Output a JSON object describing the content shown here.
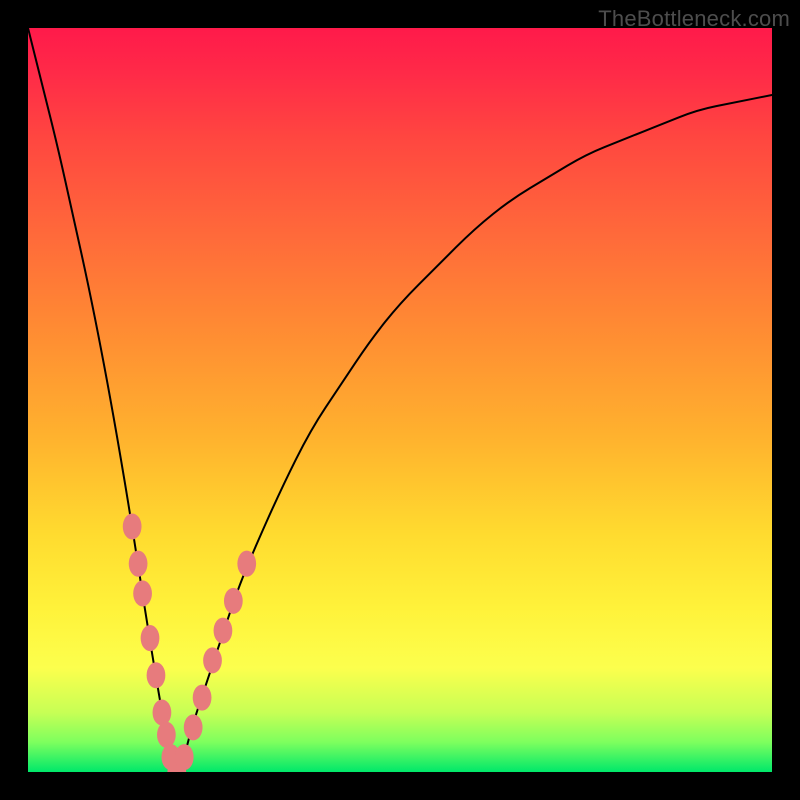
{
  "watermark": "TheBottleneck.com",
  "colors": {
    "frame": "#000000",
    "marker": "#e77b7d",
    "gradient_top": "#ff1a4a",
    "gradient_bottom": "#00e86a"
  },
  "chart_data": {
    "type": "line",
    "title": "",
    "xlabel": "",
    "ylabel": "",
    "xlim": [
      0,
      100
    ],
    "ylim": [
      0,
      100
    ],
    "grid": false,
    "legend": false,
    "series": [
      {
        "name": "bottleneck-curve",
        "x": [
          0,
          2,
          4,
          6,
          8,
          10,
          12,
          14,
          16,
          18,
          19,
          20,
          21,
          22,
          24,
          26,
          28,
          30,
          34,
          38,
          42,
          46,
          50,
          55,
          60,
          65,
          70,
          75,
          80,
          85,
          90,
          95,
          100
        ],
        "y": [
          100,
          92,
          84,
          75,
          66,
          56,
          45,
          33,
          20,
          8,
          3,
          0,
          2,
          6,
          12,
          18,
          24,
          29,
          38,
          46,
          52,
          58,
          63,
          68,
          73,
          77,
          80,
          83,
          85,
          87,
          89,
          90,
          91
        ]
      }
    ],
    "markers": [
      {
        "x": 14.0,
        "y": 33,
        "r": 1.4
      },
      {
        "x": 14.8,
        "y": 28,
        "r": 1.4
      },
      {
        "x": 15.4,
        "y": 24,
        "r": 1.4
      },
      {
        "x": 16.4,
        "y": 18,
        "r": 1.4
      },
      {
        "x": 17.2,
        "y": 13,
        "r": 1.4
      },
      {
        "x": 18.0,
        "y": 8,
        "r": 1.4
      },
      {
        "x": 18.6,
        "y": 5,
        "r": 1.4
      },
      {
        "x": 19.2,
        "y": 2,
        "r": 1.4
      },
      {
        "x": 20.0,
        "y": 0,
        "r": 1.4
      },
      {
        "x": 21.0,
        "y": 2,
        "r": 1.4
      },
      {
        "x": 22.2,
        "y": 6,
        "r": 1.4
      },
      {
        "x": 23.4,
        "y": 10,
        "r": 1.4
      },
      {
        "x": 24.8,
        "y": 15,
        "r": 1.4
      },
      {
        "x": 26.2,
        "y": 19,
        "r": 1.4
      },
      {
        "x": 27.6,
        "y": 23,
        "r": 1.4
      },
      {
        "x": 29.4,
        "y": 28,
        "r": 1.4
      }
    ]
  }
}
